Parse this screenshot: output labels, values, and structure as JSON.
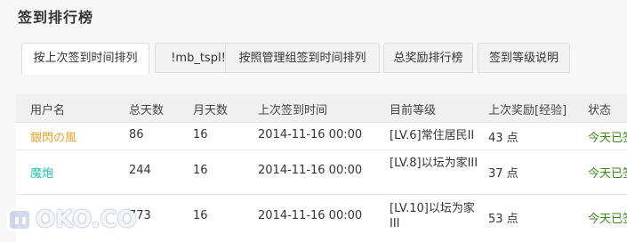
{
  "page": {
    "title": "签到排行榜"
  },
  "tabs": [
    {
      "label": "按上次签到时间排列",
      "active": true
    },
    {
      "label": "!mb_tspl!",
      "active": false
    },
    {
      "label": "按照管理组签到时间排列",
      "active": false
    },
    {
      "label": "总奖励排行榜",
      "active": false
    },
    {
      "label": "签到等级说明",
      "active": false
    }
  ],
  "table": {
    "headers": [
      "用户名",
      "总天数",
      "月天数",
      "上次签到时间",
      "目前等级",
      "上次奖励[经验]",
      "状态"
    ],
    "rows": [
      {
        "name": "銀閃の風",
        "name_color": "#f0a02a",
        "total": "86",
        "month": "16",
        "last": "2014-11-16 00:00",
        "level": "[LV.6]常住居民II",
        "reward": "43 点",
        "status": "今天已签"
      },
      {
        "name": "魔炮",
        "name_color": "#26c0b0",
        "total": "244",
        "month": "16",
        "last": "2014-11-16 00:00",
        "level": "[LV.8]以坛为家III",
        "reward": "37 点",
        "status": "今天已签"
      },
      {
        "name": "",
        "name_color": "#26c0b0",
        "total": "773",
        "month": "16",
        "last": "2014-11-16 00:00",
        "level": "[LV.10]以坛为家III",
        "reward": "53 点",
        "status": "今天已签"
      }
    ]
  },
  "watermark": {
    "text": "OKO.CO"
  }
}
